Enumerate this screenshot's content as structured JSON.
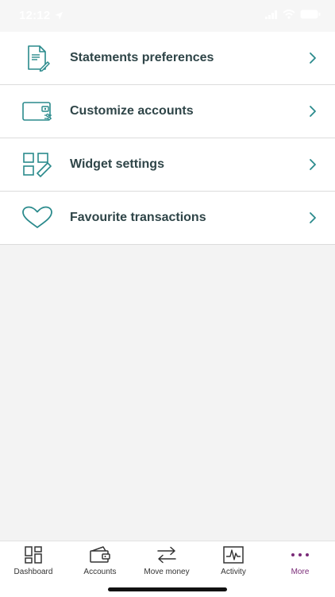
{
  "status_bar": {
    "time": "12:12"
  },
  "menu": {
    "items": [
      {
        "label": "Statements preferences",
        "icon": "document-edit-icon"
      },
      {
        "label": "Customize accounts",
        "icon": "card-settings-icon"
      },
      {
        "label": "Widget settings",
        "icon": "widget-grid-edit-icon"
      },
      {
        "label": "Favourite transactions",
        "icon": "heart-icon"
      }
    ]
  },
  "tab_bar": {
    "tabs": [
      {
        "label": "Dashboard",
        "icon": "dashboard-icon"
      },
      {
        "label": "Accounts",
        "icon": "wallet-icon"
      },
      {
        "label": "Move money",
        "icon": "transfer-arrows-icon"
      },
      {
        "label": "Activity",
        "icon": "activity-chart-icon"
      },
      {
        "label": "More",
        "icon": "more-dots-icon",
        "active": true
      }
    ]
  },
  "colors": {
    "accent_teal": "#2a8a8c",
    "text_dark": "#2f4548",
    "active_tab": "#7a2b78",
    "background": "#f3f3f3"
  }
}
